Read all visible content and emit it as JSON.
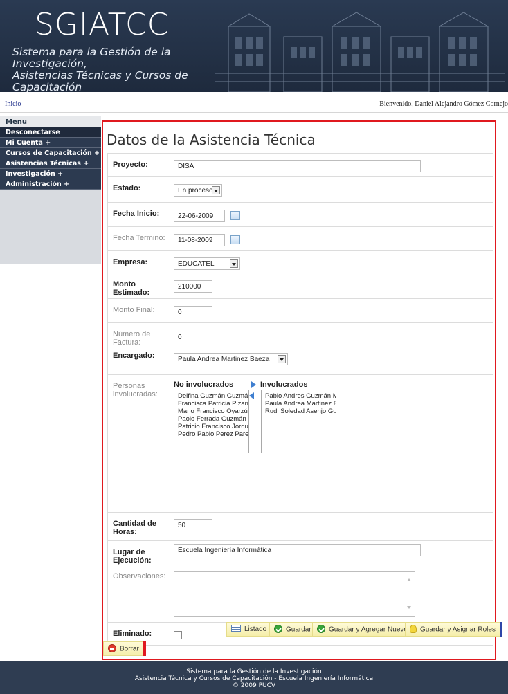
{
  "header": {
    "logo": "SGIATCC",
    "subtitle_line1": "Sistema para la Gestión de la Investigación,",
    "subtitle_line2": "Asistencias Técnicas y Cursos de Capacitación"
  },
  "topbar": {
    "home_link": "Inicio",
    "welcome": "Bienvenido, Daniel Alejandro Gómez Cornejo"
  },
  "sidebar": {
    "title": "Menu",
    "items": [
      {
        "label": "Desconectarse"
      },
      {
        "label": "Mi Cuenta +"
      },
      {
        "label": "Cursos de Capacitación +"
      },
      {
        "label": "Asistencias Técnicas +"
      },
      {
        "label": "Investigación +"
      },
      {
        "label": "Administración +"
      }
    ]
  },
  "form": {
    "title": "Datos de la Asistencia Técnica",
    "fields": {
      "proyecto": {
        "label": "Proyecto:",
        "value": "DISA"
      },
      "estado": {
        "label": "Estado:",
        "value": "En proceso"
      },
      "fecha_inicio": {
        "label": "Fecha Inicio:",
        "value": "22-06-2009"
      },
      "fecha_termino": {
        "label": "Fecha Termino:",
        "value": "11-08-2009"
      },
      "empresa": {
        "label": "Empresa:",
        "value": "EDUCATEL"
      },
      "monto_estimado": {
        "label": "Monto Estimado:",
        "value": "210000"
      },
      "monto_final": {
        "label": "Monto Final:",
        "value": "0"
      },
      "numero_factura": {
        "label": "Número de Factura:",
        "value": "0"
      },
      "encargado": {
        "label": "Encargado:",
        "value": "Paula Andrea Martinez Baeza"
      },
      "personas": {
        "label": "Personas involucradas:",
        "no_involucrados_header": "No involucrados",
        "involucrados_header": "Involucrados",
        "no_involucrados": [
          "Delfina Guzmán Guzmán",
          "Francisca Patricia Pizarro",
          "Mario Francisco Oyarzún",
          "Paolo Ferrada Guzmán",
          "Patricio Francisco Jorque",
          "Pedro Pablo Perez Paredes"
        ],
        "involucrados": [
          "Pablo Andres Guzmán Ma",
          "Paula Andrea Martinez Ba",
          "Rudi Soledad Asenjo Gua"
        ]
      },
      "cantidad_horas": {
        "label": "Cantidad de Horas:",
        "value": "50"
      },
      "lugar_ejecucion": {
        "label": "Lugar de Ejecución:",
        "value": "Escuela Ingeniería Informática"
      },
      "observaciones": {
        "label": "Observaciones:",
        "value": ""
      },
      "eliminado": {
        "label": "Eliminado:",
        "checked": false
      }
    },
    "buttons": {
      "listado": "Listado",
      "guardar": "Guardar",
      "guardar_nuevo": "Guardar y Agregar Nuevo",
      "guardar_roles": "Guardar y Asignar Roles",
      "borrar": "Borrar"
    }
  },
  "footer": {
    "line1": "Sistema para la Gestión de la Investigación",
    "line2": "Asistencia Técnica y Cursos de Capacitación - Escuela Ingeniería Informática",
    "line3": "© 2009 PUCV"
  },
  "colors": {
    "header_bg": "#1e2a3d",
    "sidebar_item_bg": "#2c3a50",
    "frame_red": "#e0191f",
    "button_bg": "#f7f1b5",
    "footer_bg": "#2f3d52"
  }
}
